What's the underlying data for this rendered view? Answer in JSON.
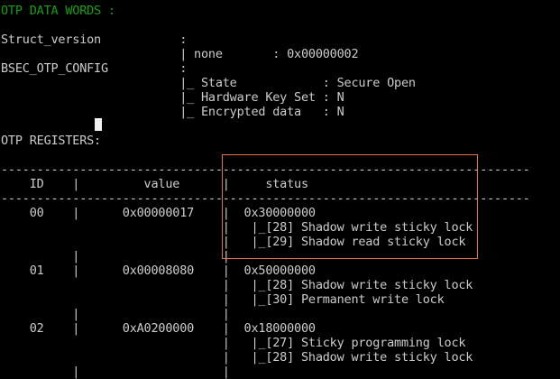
{
  "colors": {
    "background": "#000000",
    "text": "#cccccc",
    "header_green": "#13a10e",
    "highlight_border": "#e8734a",
    "cursor": "#f2f2f2"
  },
  "lines": [
    "OTP DATA WORDS :",
    "Struct_version           :",
    "                         | none       : 0x00000002",
    "BSEC_OTP_CONFIG          :",
    "                         |_ State            : Secure Open",
    "                         |_ Hardware Key Set : N",
    "                         |_ Encrypted data   : N",
    "OTP REGISTERS:",
    "--------------------------------------------------------------------------",
    "    ID    |         value      |     status",
    "--------------------------------------------------------------------------",
    "    00    |      0x00000017    |  0x30000000",
    "                               |   |_[28] Shadow write sticky lock",
    "                               |   |_[29] Shadow read sticky lock",
    "          |                    |",
    "    01    |      0x00008080    |  0x50000000",
    "                               |   |_[28] Shadow write sticky lock",
    "                               |   |_[30] Permanent write lock",
    "          |                    |",
    "    02    |      0xA0200000    |  0x18000000",
    "                               |   |_[27] Sticky programming lock",
    "                               |   |_[28] Shadow write sticky lock",
    "          |                    |"
  ]
}
